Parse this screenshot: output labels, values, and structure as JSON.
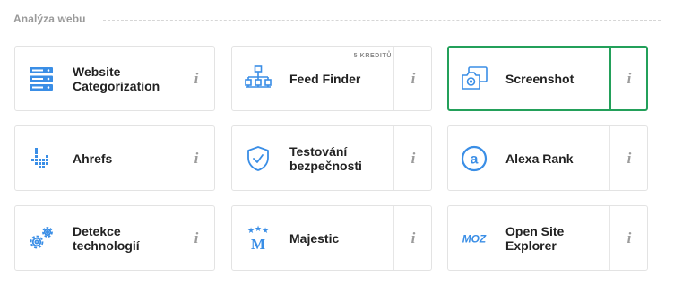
{
  "section": {
    "title": "Analýza webu"
  },
  "info_label": "i",
  "accent": "#3a8ee6",
  "active_border": "#23a05a",
  "tools": [
    {
      "label": "Website Categorization",
      "icon": "server-stack-icon"
    },
    {
      "label": "Feed Finder",
      "icon": "sitemap-icon",
      "badge": "5 KREDITŮ"
    },
    {
      "label": "Screenshot",
      "icon": "camera-screenshot-icon",
      "active": true
    },
    {
      "label": "Ahrefs",
      "icon": "ahrefs-icon"
    },
    {
      "label": "Testování bezpečnosti",
      "icon": "shield-check-icon"
    },
    {
      "label": "Alexa Rank",
      "icon": "alexa-icon"
    },
    {
      "label": "Detekce technologií",
      "icon": "gears-icon"
    },
    {
      "label": "Majestic",
      "icon": "majestic-icon"
    },
    {
      "label": "Open Site Explorer",
      "icon": "moz-icon"
    }
  ]
}
